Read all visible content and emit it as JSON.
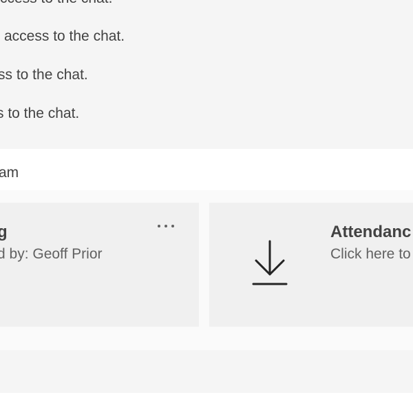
{
  "chat": {
    "lines": [
      "ccess to the chat.",
      "access to the chat.",
      "ss to the chat.",
      "s to the chat."
    ]
  },
  "team": {
    "label": "am"
  },
  "cards": {
    "left": {
      "title": "g",
      "subtitle": "d by: Geoff Prior",
      "more_icon": "more-horizontal-icon"
    },
    "right": {
      "title": "Attendanc",
      "subtitle": "Click here to",
      "icon": "download-icon"
    }
  }
}
